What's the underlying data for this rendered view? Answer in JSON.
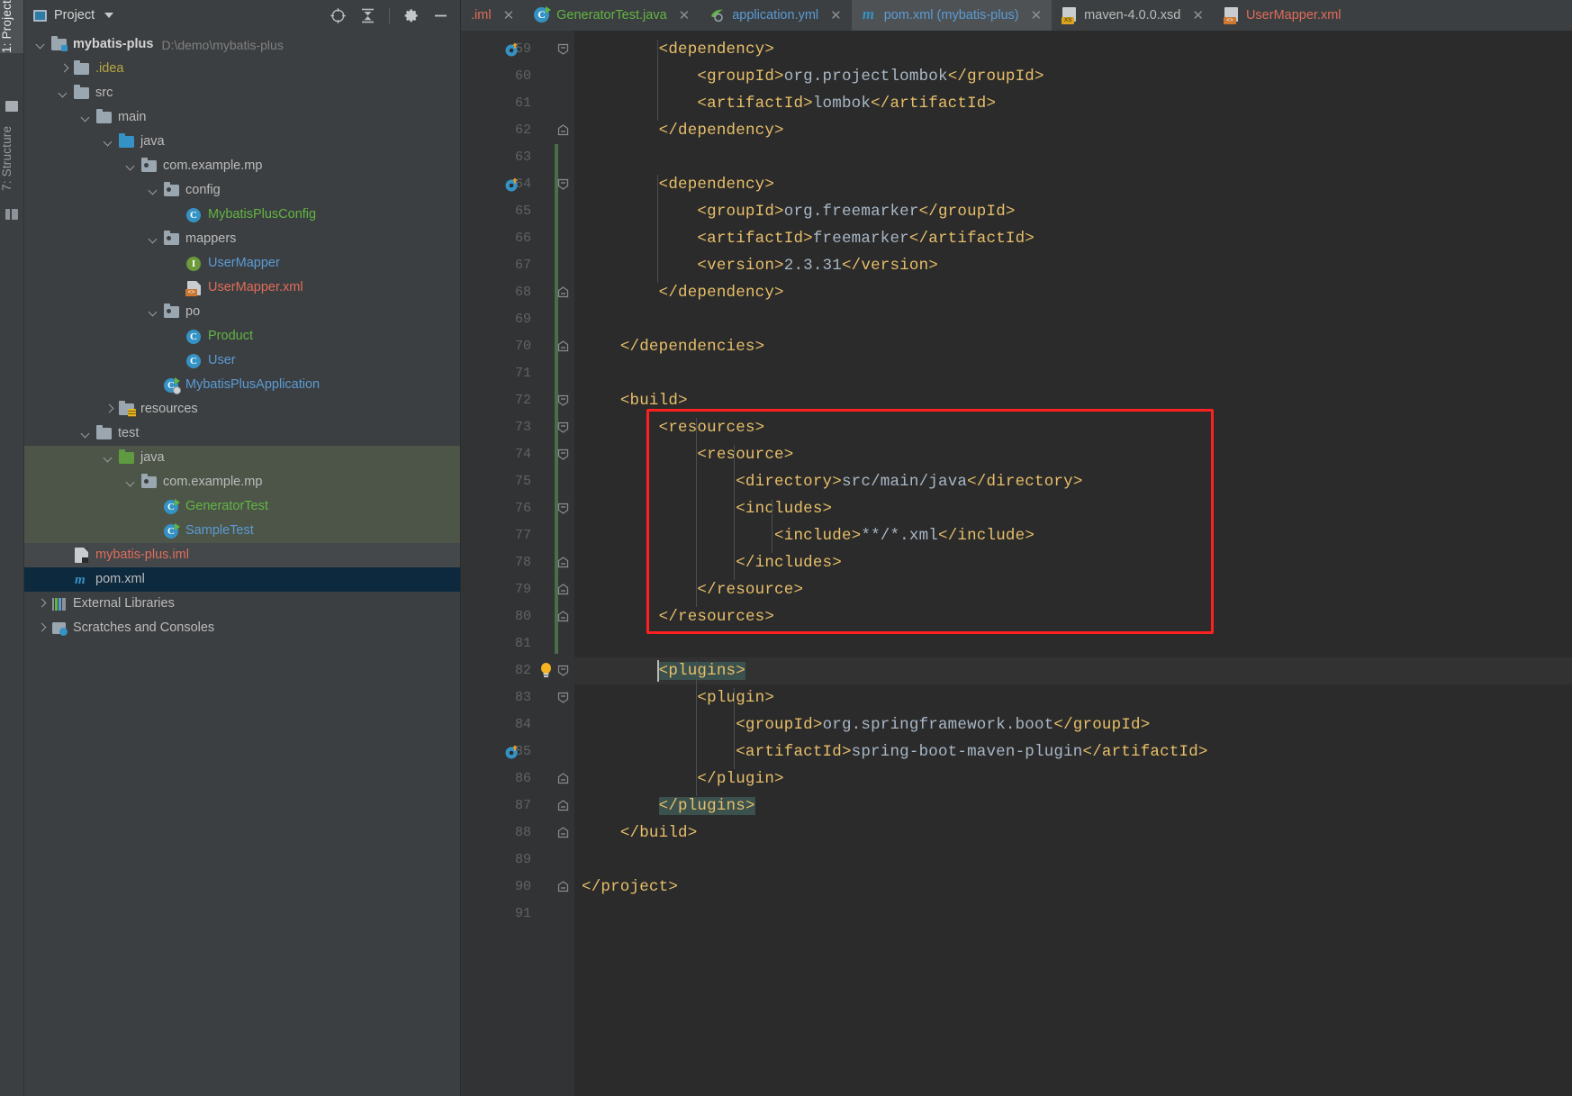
{
  "toolwindows": {
    "project_tab": "1: Project",
    "structure_tab": "7: Structure"
  },
  "project_panel": {
    "title": "Project",
    "actions": [
      {
        "name": "locate-icon",
        "tooltip": "Select Opened File"
      },
      {
        "name": "collapse-all-icon",
        "tooltip": "Collapse All"
      },
      {
        "name": "gear-icon",
        "tooltip": "Settings"
      },
      {
        "name": "hide-icon",
        "tooltip": "Hide"
      }
    ],
    "tree": [
      {
        "label": "mybatis-plus",
        "sub": "D:\\demo\\mybatis-plus",
        "indent": 0,
        "arrow": "down",
        "icon": "module-folder",
        "color": "#d4d4d4",
        "bold": true,
        "sel": ""
      },
      {
        "label": ".idea",
        "sub": "",
        "indent": 1,
        "arrow": "right",
        "icon": "folder-grey",
        "color": "#b5a642",
        "bold": false,
        "sel": ""
      },
      {
        "label": "src",
        "sub": "",
        "indent": 1,
        "arrow": "down",
        "icon": "folder-grey",
        "color": "#bbbbbb",
        "bold": false,
        "sel": ""
      },
      {
        "label": "main",
        "sub": "",
        "indent": 2,
        "arrow": "down",
        "icon": "folder-grey",
        "color": "#bbbbbb",
        "bold": false,
        "sel": ""
      },
      {
        "label": "java",
        "sub": "",
        "indent": 3,
        "arrow": "down",
        "icon": "folder-blue",
        "color": "#bbbbbb",
        "bold": false,
        "sel": ""
      },
      {
        "label": "com.example.mp",
        "sub": "",
        "indent": 4,
        "arrow": "down",
        "icon": "package",
        "color": "#bbbbbb",
        "bold": false,
        "sel": ""
      },
      {
        "label": "config",
        "sub": "",
        "indent": 5,
        "arrow": "down",
        "icon": "package",
        "color": "#bbbbbb",
        "bold": false,
        "sel": ""
      },
      {
        "label": "MybatisPlusConfig",
        "sub": "",
        "indent": 6,
        "arrow": "none",
        "icon": "class",
        "color": "#62b543",
        "bold": false,
        "sel": ""
      },
      {
        "label": "mappers",
        "sub": "",
        "indent": 5,
        "arrow": "down",
        "icon": "package",
        "color": "#bbbbbb",
        "bold": false,
        "sel": ""
      },
      {
        "label": "UserMapper",
        "sub": "",
        "indent": 6,
        "arrow": "none",
        "icon": "interface",
        "color": "#5a9bd5",
        "bold": false,
        "sel": ""
      },
      {
        "label": "UserMapper.xml",
        "sub": "",
        "indent": 6,
        "arrow": "none",
        "icon": "xml-file",
        "color": "#e06c5a",
        "bold": false,
        "sel": ""
      },
      {
        "label": "po",
        "sub": "",
        "indent": 5,
        "arrow": "down",
        "icon": "package",
        "color": "#bbbbbb",
        "bold": false,
        "sel": ""
      },
      {
        "label": "Product",
        "sub": "",
        "indent": 6,
        "arrow": "none",
        "icon": "class",
        "color": "#62b543",
        "bold": false,
        "sel": ""
      },
      {
        "label": "User",
        "sub": "",
        "indent": 6,
        "arrow": "none",
        "icon": "class",
        "color": "#5a9bd5",
        "bold": false,
        "sel": ""
      },
      {
        "label": "MybatisPlusApplication",
        "sub": "",
        "indent": 5,
        "arrow": "none",
        "icon": "spring-class",
        "color": "#5a9bd5",
        "bold": false,
        "sel": ""
      },
      {
        "label": "resources",
        "sub": "",
        "indent": 3,
        "arrow": "right",
        "icon": "folder-resources",
        "color": "#bbbbbb",
        "bold": false,
        "sel": ""
      },
      {
        "label": "test",
        "sub": "",
        "indent": 2,
        "arrow": "down",
        "icon": "folder-grey",
        "color": "#bbbbbb",
        "bold": false,
        "sel": ""
      },
      {
        "label": "java",
        "sub": "",
        "indent": 3,
        "arrow": "down",
        "icon": "folder-green",
        "color": "#bbbbbb",
        "bold": false,
        "sel": "sel-green"
      },
      {
        "label": "com.example.mp",
        "sub": "",
        "indent": 4,
        "arrow": "down",
        "icon": "package",
        "color": "#bbbbbb",
        "bold": false,
        "sel": "sel-green"
      },
      {
        "label": "GeneratorTest",
        "sub": "",
        "indent": 5,
        "arrow": "none",
        "icon": "test-class",
        "color": "#62b543",
        "bold": false,
        "sel": "sel-green"
      },
      {
        "label": "SampleTest",
        "sub": "",
        "indent": 5,
        "arrow": "none",
        "icon": "test-class",
        "color": "#5a9bd5",
        "bold": false,
        "sel": "sel-green"
      },
      {
        "label": "mybatis-plus.iml",
        "sub": "",
        "indent": 1,
        "arrow": "none",
        "icon": "iml-file",
        "color": "#e06c5a",
        "bold": false,
        "sel": "sel-grey"
      },
      {
        "label": "pom.xml",
        "sub": "",
        "indent": 1,
        "arrow": "none",
        "icon": "maven-file",
        "color": "#bbbbbb",
        "bold": false,
        "sel": "sel-blue"
      },
      {
        "label": "External Libraries",
        "sub": "",
        "indent": 0,
        "arrow": "right",
        "icon": "libraries",
        "color": "#bbbbbb",
        "bold": false,
        "sel": ""
      },
      {
        "label": "Scratches and Consoles",
        "sub": "",
        "indent": 0,
        "arrow": "right",
        "icon": "scratches",
        "color": "#bbbbbb",
        "bold": false,
        "sel": ""
      }
    ]
  },
  "editor": {
    "tabs": [
      {
        "label": ".iml",
        "icon": "iml-file-icon",
        "color": "#e06c5a",
        "active": false,
        "closable": true
      },
      {
        "label": "GeneratorTest.java",
        "icon": "test-class-icon",
        "color": "#62b543",
        "active": false,
        "closable": true
      },
      {
        "label": "application.yml",
        "icon": "spring-yaml-icon",
        "color": "#5a9bd5",
        "active": false,
        "closable": true
      },
      {
        "label": "pom.xml (mybatis-plus)",
        "icon": "maven-icon",
        "color": "#5a9bd5",
        "active": true,
        "closable": true
      },
      {
        "label": "maven-4.0.0.xsd",
        "icon": "xsd-file-icon",
        "color": "#bbbbbb",
        "active": false,
        "closable": true
      },
      {
        "label": "UserMapper.xml",
        "icon": "xml-file-icon",
        "color": "#e06c5a",
        "active": false,
        "closable": false
      }
    ],
    "first_line_number": 59,
    "lines": [
      {
        "n": 59,
        "indent": 0,
        "fold": "collapse-top",
        "runicon": true,
        "tokens": [
          {
            "t": "        ",
            "c": "plain"
          },
          {
            "t": "<dependency>",
            "c": "tag"
          }
        ]
      },
      {
        "n": 60,
        "indent": 0,
        "fold": "",
        "runicon": false,
        "tokens": [
          {
            "t": "            ",
            "c": "plain"
          },
          {
            "t": "<groupId>",
            "c": "tag"
          },
          {
            "t": "org.projectlombok",
            "c": "text"
          },
          {
            "t": "</groupId>",
            "c": "tag"
          }
        ]
      },
      {
        "n": 61,
        "indent": 0,
        "fold": "",
        "runicon": false,
        "tokens": [
          {
            "t": "            ",
            "c": "plain"
          },
          {
            "t": "<artifactId>",
            "c": "tag"
          },
          {
            "t": "lombok",
            "c": "text"
          },
          {
            "t": "</artifactId>",
            "c": "tag"
          }
        ]
      },
      {
        "n": 62,
        "indent": 0,
        "fold": "collapse-bottom",
        "runicon": false,
        "tokens": [
          {
            "t": "        ",
            "c": "plain"
          },
          {
            "t": "</dependency>",
            "c": "tag"
          }
        ]
      },
      {
        "n": 63,
        "indent": 0,
        "fold": "",
        "runicon": false,
        "tokens": []
      },
      {
        "n": 64,
        "indent": 0,
        "fold": "collapse-top",
        "runicon": true,
        "tokens": [
          {
            "t": "        ",
            "c": "plain"
          },
          {
            "t": "<dependency>",
            "c": "tag"
          }
        ]
      },
      {
        "n": 65,
        "indent": 0,
        "fold": "",
        "runicon": false,
        "tokens": [
          {
            "t": "            ",
            "c": "plain"
          },
          {
            "t": "<groupId>",
            "c": "tag"
          },
          {
            "t": "org.freemarker",
            "c": "text"
          },
          {
            "t": "</groupId>",
            "c": "tag"
          }
        ]
      },
      {
        "n": 66,
        "indent": 0,
        "fold": "",
        "runicon": false,
        "tokens": [
          {
            "t": "            ",
            "c": "plain"
          },
          {
            "t": "<artifactId>",
            "c": "tag"
          },
          {
            "t": "freemarker",
            "c": "text"
          },
          {
            "t": "</artifactId>",
            "c": "tag"
          }
        ]
      },
      {
        "n": 67,
        "indent": 0,
        "fold": "",
        "runicon": false,
        "tokens": [
          {
            "t": "            ",
            "c": "plain"
          },
          {
            "t": "<version>",
            "c": "tag"
          },
          {
            "t": "2.3.31",
            "c": "text"
          },
          {
            "t": "</version>",
            "c": "tag"
          }
        ]
      },
      {
        "n": 68,
        "indent": 0,
        "fold": "collapse-bottom",
        "runicon": false,
        "tokens": [
          {
            "t": "        ",
            "c": "plain"
          },
          {
            "t": "</dependency>",
            "c": "tag"
          }
        ]
      },
      {
        "n": 69,
        "indent": 0,
        "fold": "",
        "runicon": false,
        "tokens": []
      },
      {
        "n": 70,
        "indent": 0,
        "fold": "collapse-bottom",
        "runicon": false,
        "tokens": [
          {
            "t": "    ",
            "c": "plain"
          },
          {
            "t": "</dependencies>",
            "c": "tag"
          }
        ]
      },
      {
        "n": 71,
        "indent": 0,
        "fold": "",
        "runicon": false,
        "tokens": []
      },
      {
        "n": 72,
        "indent": 0,
        "fold": "collapse-top",
        "runicon": false,
        "tokens": [
          {
            "t": "    ",
            "c": "plain"
          },
          {
            "t": "<build>",
            "c": "tag"
          }
        ]
      },
      {
        "n": 73,
        "indent": 0,
        "fold": "collapse-top",
        "runicon": false,
        "tokens": [
          {
            "t": "        ",
            "c": "plain"
          },
          {
            "t": "<resources>",
            "c": "tag"
          }
        ]
      },
      {
        "n": 74,
        "indent": 0,
        "fold": "collapse-top",
        "runicon": false,
        "tokens": [
          {
            "t": "            ",
            "c": "plain"
          },
          {
            "t": "<resource>",
            "c": "tag"
          }
        ]
      },
      {
        "n": 75,
        "indent": 0,
        "fold": "",
        "runicon": false,
        "tokens": [
          {
            "t": "                ",
            "c": "plain"
          },
          {
            "t": "<directory>",
            "c": "tag"
          },
          {
            "t": "src/main/java",
            "c": "text"
          },
          {
            "t": "</directory>",
            "c": "tag"
          }
        ]
      },
      {
        "n": 76,
        "indent": 0,
        "fold": "collapse-top",
        "runicon": false,
        "tokens": [
          {
            "t": "                ",
            "c": "plain"
          },
          {
            "t": "<includes>",
            "c": "tag"
          }
        ]
      },
      {
        "n": 77,
        "indent": 0,
        "fold": "",
        "runicon": false,
        "tokens": [
          {
            "t": "                    ",
            "c": "plain"
          },
          {
            "t": "<include>",
            "c": "tag"
          },
          {
            "t": "**/*.xml",
            "c": "text"
          },
          {
            "t": "</include>",
            "c": "tag"
          }
        ]
      },
      {
        "n": 78,
        "indent": 0,
        "fold": "collapse-bottom",
        "runicon": false,
        "tokens": [
          {
            "t": "                ",
            "c": "plain"
          },
          {
            "t": "</includes>",
            "c": "tag"
          }
        ]
      },
      {
        "n": 79,
        "indent": 0,
        "fold": "collapse-bottom",
        "runicon": false,
        "tokens": [
          {
            "t": "            ",
            "c": "plain"
          },
          {
            "t": "</resource>",
            "c": "tag"
          }
        ]
      },
      {
        "n": 80,
        "indent": 0,
        "fold": "collapse-bottom",
        "runicon": false,
        "tokens": [
          {
            "t": "        ",
            "c": "plain"
          },
          {
            "t": "</resources>",
            "c": "tag"
          }
        ]
      },
      {
        "n": 81,
        "indent": 0,
        "fold": "",
        "runicon": false,
        "tokens": []
      },
      {
        "n": 82,
        "indent": 0,
        "fold": "collapse-top",
        "runicon": false,
        "bulb": true,
        "current": true,
        "tokens": [
          {
            "t": "        ",
            "c": "plain"
          },
          {
            "t": "<plugins>",
            "c": "tag-hl"
          }
        ]
      },
      {
        "n": 83,
        "indent": 0,
        "fold": "collapse-top",
        "runicon": false,
        "tokens": [
          {
            "t": "            ",
            "c": "plain"
          },
          {
            "t": "<plugin>",
            "c": "tag"
          }
        ]
      },
      {
        "n": 84,
        "indent": 0,
        "fold": "",
        "runicon": false,
        "tokens": [
          {
            "t": "                ",
            "c": "plain"
          },
          {
            "t": "<groupId>",
            "c": "tag"
          },
          {
            "t": "org.springframework.boot",
            "c": "text"
          },
          {
            "t": "</groupId>",
            "c": "tag"
          }
        ]
      },
      {
        "n": 85,
        "indent": 0,
        "fold": "",
        "runicon": true,
        "tokens": [
          {
            "t": "                ",
            "c": "plain"
          },
          {
            "t": "<artifactId>",
            "c": "tag"
          },
          {
            "t": "spring-boot-maven-plugin",
            "c": "text"
          },
          {
            "t": "</artifactId>",
            "c": "tag"
          }
        ]
      },
      {
        "n": 86,
        "indent": 0,
        "fold": "collapse-bottom",
        "runicon": false,
        "tokens": [
          {
            "t": "            ",
            "c": "plain"
          },
          {
            "t": "</plugin>",
            "c": "tag"
          }
        ]
      },
      {
        "n": 87,
        "indent": 0,
        "fold": "collapse-bottom",
        "runicon": false,
        "tokens": [
          {
            "t": "        ",
            "c": "plain"
          },
          {
            "t": "</plugins>",
            "c": "tag-hl"
          }
        ]
      },
      {
        "n": 88,
        "indent": 0,
        "fold": "collapse-bottom",
        "runicon": false,
        "tokens": [
          {
            "t": "    ",
            "c": "plain"
          },
          {
            "t": "</build>",
            "c": "tag"
          }
        ]
      },
      {
        "n": 89,
        "indent": 0,
        "fold": "",
        "runicon": false,
        "tokens": []
      },
      {
        "n": 90,
        "indent": 0,
        "fold": "collapse-bottom",
        "runicon": false,
        "tokens": [
          {
            "t": "",
            "c": "plain"
          },
          {
            "t": "</project>",
            "c": "tag"
          }
        ]
      },
      {
        "n": 91,
        "indent": 0,
        "fold": "",
        "runicon": false,
        "tokens": []
      }
    ],
    "annotation": {
      "redbox_label": "resources-block-highlight",
      "redbox_color": "#ff2020"
    }
  }
}
